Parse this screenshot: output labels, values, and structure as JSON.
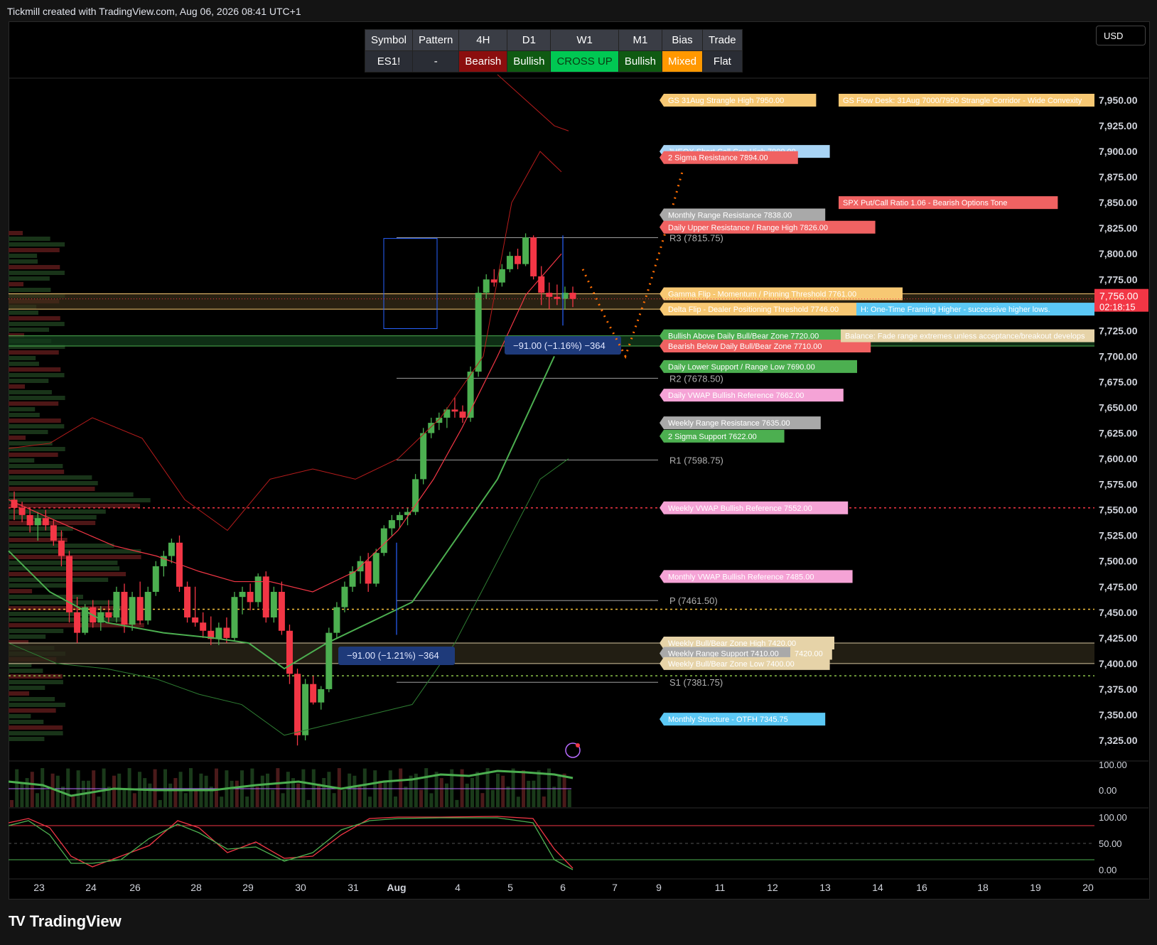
{
  "header": {
    "title": "Tickmill created with TradingView.com, Aug 06, 2026 08:41 UTC+1"
  },
  "currency_button": "USD",
  "brand": {
    "name": "TradingView",
    "logo_text": "TV"
  },
  "status_table": {
    "headers": [
      "Symbol",
      "Pattern",
      "4H",
      "D1",
      "W1",
      "M1",
      "Bias",
      "Trade"
    ],
    "values": [
      "ES1!",
      "-",
      "Bearish",
      "Bullish",
      "CROSS UP",
      "Bullish",
      "Mixed",
      "Flat"
    ],
    "value_colors": [
      "#2a2d35",
      "#2a2d35",
      "#8b0e0e",
      "#0f5a12",
      "#00c853",
      "#0f5a12",
      "#ff9800",
      "#2a2d35"
    ],
    "value_text_colors": [
      "#ffffff",
      "#ffffff",
      "#ffffff",
      "#ffffff",
      "#0a3b12",
      "#ffffff",
      "#ffffff",
      "#ffffff"
    ]
  },
  "chart_data": {
    "type": "candlestick",
    "symbol": "ES1!",
    "ylim": [
      7300,
      7975
    ],
    "y_ticks": [
      7325,
      7350,
      7375,
      7400,
      7425,
      7450,
      7475,
      7500,
      7525,
      7550,
      7575,
      7600,
      7625,
      7650,
      7675,
      7700,
      7725,
      7750,
      7775,
      7800,
      7825,
      7850,
      7875,
      7900,
      7925,
      7950
    ],
    "y_tick_labels": [
      "7,325.00",
      "7,350.00",
      "7,375.00",
      "7,400.00",
      "7,425.00",
      "7,450.00",
      "7,475.00",
      "7,500.00",
      "7,525.00",
      "7,550.00",
      "7,575.00",
      "7,600.00",
      "7,625.00",
      "7,650.00",
      "7,675.00",
      "7,700.00",
      "7,725.00",
      "7,750.00",
      "7,775.00",
      "7,800.00",
      "7,825.00",
      "7,850.00",
      "7,875.00",
      "7,900.00",
      "7,925.00",
      "7,950.00"
    ],
    "x_labels": [
      "23",
      "24",
      "26",
      "28",
      "29",
      "30",
      "31",
      "Aug",
      "4",
      "5",
      "6",
      "7",
      "9",
      "11",
      "12",
      "13",
      "14",
      "16",
      "18",
      "19",
      "20"
    ],
    "last_price": {
      "value": 7756.0,
      "label": "7,756.00",
      "countdown": "02:18:15",
      "color": "#f23645"
    },
    "candles": [
      [
        7560,
        7568,
        7540,
        7552
      ],
      [
        7552,
        7558,
        7538,
        7545
      ],
      [
        7545,
        7552,
        7528,
        7535
      ],
      [
        7535,
        7548,
        7520,
        7542
      ],
      [
        7542,
        7550,
        7530,
        7535
      ],
      [
        7535,
        7540,
        7515,
        7520
      ],
      [
        7520,
        7530,
        7495,
        7505
      ],
      [
        7505,
        7510,
        7440,
        7450
      ],
      [
        7450,
        7465,
        7420,
        7430
      ],
      [
        7430,
        7458,
        7428,
        7455
      ],
      [
        7455,
        7462,
        7435,
        7440
      ],
      [
        7440,
        7456,
        7432,
        7450
      ],
      [
        7450,
        7462,
        7440,
        7445
      ],
      [
        7445,
        7475,
        7440,
        7470
      ],
      [
        7470,
        7478,
        7430,
        7438
      ],
      [
        7438,
        7470,
        7432,
        7465
      ],
      [
        7465,
        7480,
        7438,
        7442
      ],
      [
        7442,
        7475,
        7438,
        7470
      ],
      [
        7470,
        7500,
        7466,
        7495
      ],
      [
        7495,
        7510,
        7485,
        7505
      ],
      [
        7505,
        7522,
        7498,
        7518
      ],
      [
        7518,
        7525,
        7470,
        7475
      ],
      [
        7475,
        7480,
        7440,
        7445
      ],
      [
        7445,
        7475,
        7436,
        7440
      ],
      [
        7440,
        7450,
        7425,
        7432
      ],
      [
        7432,
        7446,
        7418,
        7424
      ],
      [
        7424,
        7440,
        7418,
        7435
      ],
      [
        7435,
        7445,
        7420,
        7425
      ],
      [
        7425,
        7470,
        7422,
        7465
      ],
      [
        7465,
        7475,
        7448,
        7470
      ],
      [
        7470,
        7478,
        7452,
        7460
      ],
      [
        7460,
        7488,
        7455,
        7485
      ],
      [
        7485,
        7490,
        7440,
        7445
      ],
      [
        7445,
        7475,
        7440,
        7470
      ],
      [
        7470,
        7480,
        7428,
        7432
      ],
      [
        7432,
        7438,
        7380,
        7390
      ],
      [
        7390,
        7395,
        7320,
        7330
      ],
      [
        7330,
        7385,
        7325,
        7380
      ],
      [
        7380,
        7388,
        7360,
        7362
      ],
      [
        7362,
        7378,
        7355,
        7375
      ],
      [
        7375,
        7435,
        7372,
        7430
      ],
      [
        7430,
        7460,
        7425,
        7455
      ],
      [
        7455,
        7480,
        7450,
        7475
      ],
      [
        7475,
        7495,
        7470,
        7490
      ],
      [
        7490,
        7505,
        7478,
        7500
      ],
      [
        7500,
        7508,
        7470,
        7478
      ],
      [
        7478,
        7512,
        7475,
        7508
      ],
      [
        7508,
        7535,
        7505,
        7532
      ],
      [
        7532,
        7545,
        7525,
        7540
      ],
      [
        7540,
        7548,
        7532,
        7545
      ],
      [
        7545,
        7552,
        7535,
        7548
      ],
      [
        7548,
        7585,
        7545,
        7580
      ],
      [
        7580,
        7630,
        7575,
        7625
      ],
      [
        7625,
        7640,
        7620,
        7635
      ],
      [
        7635,
        7645,
        7628,
        7640
      ],
      [
        7640,
        7650,
        7630,
        7648
      ],
      [
        7648,
        7660,
        7640,
        7646
      ],
      [
        7646,
        7652,
        7635,
        7640
      ],
      [
        7640,
        7690,
        7636,
        7685
      ],
      [
        7685,
        7768,
        7680,
        7762
      ],
      [
        7762,
        7780,
        7756,
        7775
      ],
      [
        7775,
        7785,
        7768,
        7772
      ],
      [
        7772,
        7790,
        7768,
        7785
      ],
      [
        7785,
        7802,
        7782,
        7798
      ],
      [
        7798,
        7805,
        7785,
        7790
      ],
      [
        7790,
        7820,
        7788,
        7816
      ],
      [
        7816,
        7818,
        7775,
        7778
      ],
      [
        7778,
        7788,
        7750,
        7762
      ],
      [
        7762,
        7772,
        7746,
        7758
      ],
      [
        7758,
        7770,
        7750,
        7756
      ],
      [
        7756,
        7768,
        7746,
        7762
      ],
      [
        7762,
        7768,
        7748,
        7756
      ]
    ],
    "levels": [
      {
        "label": "GS 31Aug Strangle High  7950.00",
        "price": 7950,
        "color": "#f7c873"
      },
      {
        "label": "JHEQX Short Call Cap High  7900.00",
        "price": 7900,
        "color": "#a8d4f5"
      },
      {
        "label": "2 Sigma Resistance  7894.00",
        "price": 7894,
        "color": "#f06262"
      },
      {
        "label": "Monthly Range Resistance  7838.00",
        "price": 7838,
        "color": "#a9a9a9"
      },
      {
        "label": "Daily Upper Resistance / Range High  7826.00",
        "price": 7826,
        "color": "#f06262"
      },
      {
        "label": "Gamma Flip - Momentum / Pinning Threshold  7761.00",
        "price": 7761,
        "color": "#f7c873"
      },
      {
        "label": "Delta Flip - Dealer Positioning Threshold  7746.00",
        "price": 7746,
        "color": "#f7c873"
      },
      {
        "label": "Bullish Above Daily Bull/Bear Zone  7720.00",
        "price": 7720,
        "color": "#4caf50"
      },
      {
        "label": "Bearish Below Daily Bull/Bear Zone  7710.00",
        "price": 7710,
        "color": "#f06262"
      },
      {
        "label": "Daily Lower Support / Range Low  7690.00",
        "price": 7690,
        "color": "#4caf50"
      },
      {
        "label": "Daily VWAP Bullish Reference  7662.00",
        "price": 7662,
        "color": "#f5a3d6"
      },
      {
        "label": "Weekly Range Resistance  7635.00",
        "price": 7635,
        "color": "#a9a9a9"
      },
      {
        "label": "2 Sigma Support  7622.00",
        "price": 7622,
        "color": "#4caf50"
      },
      {
        "label": "Weekly VWAP Bullish Reference  7552.00",
        "price": 7552,
        "color": "#f5a3d6"
      },
      {
        "label": "Monthly VWAP Bullish Reference  7485.00",
        "price": 7485,
        "color": "#f5a3d6"
      },
      {
        "label": "Weekly Bull/Bear Zone High  7420.00",
        "price": 7420,
        "color": "#e6d3a8"
      },
      {
        "label": "Weekly Range Support  7410.00",
        "price": 7410,
        "color": "#a9a9a9"
      },
      {
        "label": "Weekly Bull/Bear Zone Low  7400.00",
        "price": 7400,
        "color": "#e6d3a8"
      },
      {
        "label": "Monthly Structure - OTFH  7345.75",
        "price": 7345.75,
        "color": "#5bc8f5"
      }
    ],
    "side_notes": [
      {
        "label": "GS Flow Desk: 31Aug 7000/7950 Strangle Corridor - Wide Convexity",
        "price": 7950,
        "color": "#f7c873"
      },
      {
        "label": "SPX Put/Call Ratio 1.06 - Bearish Options Tone",
        "price": 7850,
        "color": "#f06262"
      },
      {
        "label": "H: One-Time Framing Higher - successive higher lows.",
        "price": 7746,
        "color": "#5bc8f5"
      },
      {
        "label": "Balance: Fade range extremes unless acceptance/breakout develops",
        "price": 7720,
        "color": "#e6d3a8"
      },
      {
        "label": "7420.00",
        "price": 7410,
        "color": "#e6d3a8"
      }
    ],
    "pivots": [
      {
        "label": "R3 (7815.75)",
        "price": 7815.75
      },
      {
        "label": "R2 (7678.50)",
        "price": 7678.5
      },
      {
        "label": "R1 (7598.75)",
        "price": 7598.75
      },
      {
        "label": "P (7461.50)",
        "price": 7461.5
      },
      {
        "label": "S1 (7381.75)",
        "price": 7381.75
      }
    ],
    "measure_labels": [
      {
        "label": "−91.00 (−1.16%) −364",
        "price": 7713
      },
      {
        "label": "−91.00 (−1.21%) −364",
        "price": 7409
      }
    ],
    "sub_pane_1": {
      "y_ticks": [
        "100.00",
        "0.00"
      ]
    },
    "sub_pane_2": {
      "y_ticks": [
        "100.00",
        "50.00",
        "0.00"
      ]
    }
  }
}
